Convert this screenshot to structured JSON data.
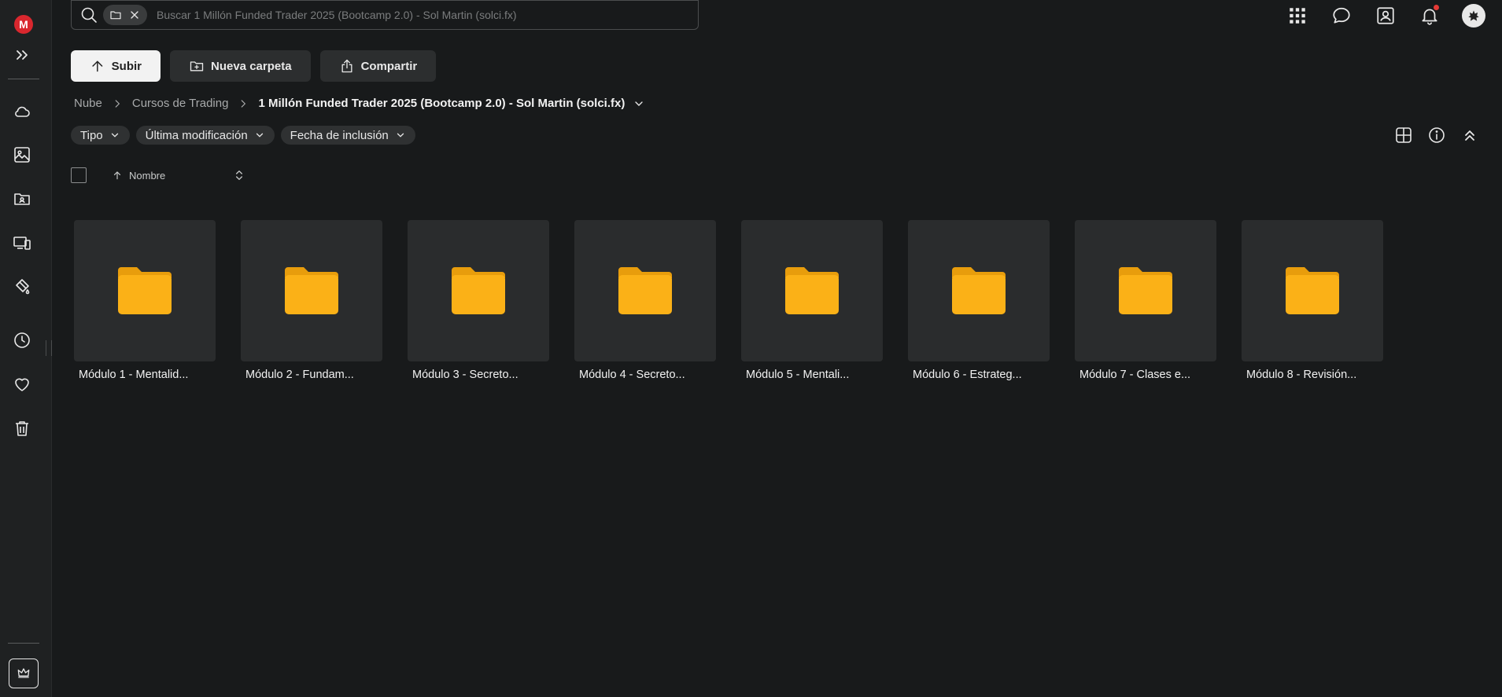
{
  "app": {
    "logo_text": "M"
  },
  "search": {
    "placeholder": "Buscar 1 Millón Funded Trader 2025 (Bootcamp 2.0) - Sol Martin (solci.fx)",
    "value": ""
  },
  "toolbar": {
    "upload_label": "Subir",
    "new_folder_label": "Nueva carpeta",
    "share_label": "Compartir"
  },
  "breadcrumb": {
    "root": "Nube",
    "parent": "Cursos de Trading",
    "current": "1 Millón Funded Trader 2025 (Bootcamp 2.0) - Sol Martin (solci.fx)"
  },
  "filters": {
    "type": "Tipo",
    "last_modified": "Última modificación",
    "date_added": "Fecha de inclusión"
  },
  "list_header": {
    "name_column": "Nombre"
  },
  "folders": [
    {
      "name": "Módulo 1 - Mentalid..."
    },
    {
      "name": "Módulo 2 - Fundam..."
    },
    {
      "name": "Módulo 3 - Secreto..."
    },
    {
      "name": "Módulo 4 - Secreto..."
    },
    {
      "name": "Módulo 5 - Mentali..."
    },
    {
      "name": "Módulo 6 - Estrateg..."
    },
    {
      "name": "Módulo 7 - Clases e..."
    },
    {
      "name": "Módulo 8 - Revisión..."
    }
  ],
  "colors": {
    "brand": "#d9272e",
    "folder": "#fbb117",
    "background": "#181a1b",
    "notification_dot": "#e53935"
  },
  "icons": {
    "sidebar": [
      "expand-icon",
      "cloud-icon",
      "photos-icon",
      "shared-folder-icon",
      "devices-icon",
      "paint-icon",
      "recents-icon",
      "favourites-icon",
      "trash-icon",
      "crown-icon"
    ],
    "top": [
      "apps-grid-icon",
      "chat-icon",
      "contacts-icon",
      "bell-icon",
      "avatar"
    ]
  }
}
